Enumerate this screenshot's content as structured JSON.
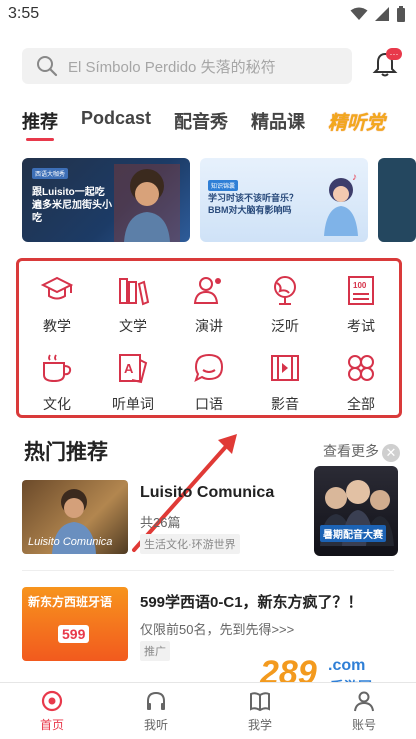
{
  "status_bar": {
    "time": "3:55"
  },
  "search": {
    "placeholder": "El Símbolo Perdido 失落的秘符"
  },
  "tabs": [
    {
      "label": "推荐",
      "active": true
    },
    {
      "label": "Podcast"
    },
    {
      "label": "配音秀"
    },
    {
      "label": "精品课"
    },
    {
      "label": "精听党",
      "promo": true
    }
  ],
  "banners": [
    {
      "tag": "西语大咖秀",
      "headline": "跟Luisito一起吃遍多米尼加街头小吃"
    },
    {
      "tag": "知识锦囊",
      "headline": "学习时该不该听音乐？BBM对大脑有影响吗"
    }
  ],
  "categories": [
    {
      "label": "教学",
      "icon": "graduation-cap-icon"
    },
    {
      "label": "文学",
      "icon": "books-icon"
    },
    {
      "label": "演讲",
      "icon": "speaker-icon"
    },
    {
      "label": "泛听",
      "icon": "globe-icon"
    },
    {
      "label": "考试",
      "icon": "exam-icon"
    },
    {
      "label": "文化",
      "icon": "cup-icon"
    },
    {
      "label": "听单词",
      "icon": "flashcard-icon"
    },
    {
      "label": "口语",
      "icon": "chat-icon"
    },
    {
      "label": "影音",
      "icon": "film-icon"
    },
    {
      "label": "全部",
      "icon": "grid-icon"
    }
  ],
  "hot": {
    "title": "热门推荐",
    "more": "查看更多",
    "items": [
      {
        "thumb_caption": "Luisito Comunica",
        "title": "Luisito Comunica",
        "sub": "共26篇",
        "tag": "生活文化·环游世界"
      },
      {
        "thumb_caption": "新东方西班牙语",
        "thumb_price": "599",
        "title": "599学西语0-C1，新东方疯了？！",
        "sub": "仅限前50名，先到先得>>>",
        "tag": "推广"
      }
    ],
    "ad_label": "暑期配音大赛"
  },
  "bottom_nav": [
    {
      "label": "首页",
      "icon": "home-icon",
      "active": true
    },
    {
      "label": "我听",
      "icon": "headphones-icon"
    },
    {
      "label": "我学",
      "icon": "book-icon"
    },
    {
      "label": "账号",
      "icon": "account-icon"
    }
  ],
  "watermark": "289.com 手游网",
  "colors": {
    "accent": "#e8394b",
    "highlight_box": "#d93a3a",
    "promo": "#f2a81d"
  }
}
